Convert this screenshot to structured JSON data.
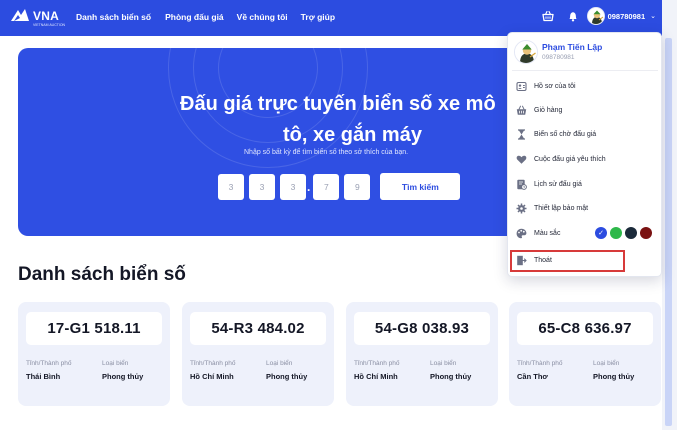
{
  "brand": {
    "name": "VNA",
    "tagline": "VIETNAM AUCTION"
  },
  "nav": {
    "links": [
      "Danh sách biển số",
      "Phòng đấu giá",
      "Về chúng tôi",
      "Trợ giúp"
    ],
    "user_phone": "098780981"
  },
  "hero": {
    "title_line1": "Đấu giá trực tuyến biển số xe mô",
    "title_line2": "tô, xe gắn máy",
    "subtitle": "Nhập số bất kỳ để tìm biển số theo sở thích của bạn.",
    "plate_digits": [
      "3",
      "3",
      "3",
      "7",
      "9"
    ],
    "search_label": "Tìm kiếm"
  },
  "list": {
    "title": "Danh sách biển số",
    "province_label": "Tỉnh/Thành phố",
    "type_label": "Loại biển",
    "cards": [
      {
        "plate": "17-G1 518.11",
        "province": "Thái Bình",
        "type": "Phong thủy"
      },
      {
        "plate": "54-R3 484.02",
        "province": "Hồ Chí Minh",
        "type": "Phong thủy"
      },
      {
        "plate": "54-G8 038.93",
        "province": "Hồ Chí Minh",
        "type": "Phong thủy"
      },
      {
        "plate": "65-C8 636.97",
        "province": "Cần Thơ",
        "type": "Phong thủy"
      }
    ]
  },
  "user_menu": {
    "name": "Phạm Tiến Lập",
    "phone": "098780981",
    "items": [
      {
        "label": "Hồ sơ của tôi",
        "icon": "profile-icon"
      },
      {
        "label": "Giỏ hàng",
        "icon": "basket-icon"
      },
      {
        "label": "Biển số chờ đấu giá",
        "icon": "hourglass-icon"
      },
      {
        "label": "Cuộc đấu giá yêu thích",
        "icon": "heart-icon"
      },
      {
        "label": "Lịch sử đấu giá",
        "icon": "history-icon"
      },
      {
        "label": "Thiết lập bảo mật",
        "icon": "gear-icon"
      },
      {
        "label": "Màu sắc",
        "icon": "palette-icon"
      },
      {
        "label": "Thoát",
        "icon": "logout-icon"
      }
    ],
    "colors": [
      "#2c4ce0",
      "#2eb84a",
      "#1b2a3a",
      "#7a1212"
    ],
    "selected_color": "#2c4ce0",
    "highlighted_item": "Thoát"
  }
}
